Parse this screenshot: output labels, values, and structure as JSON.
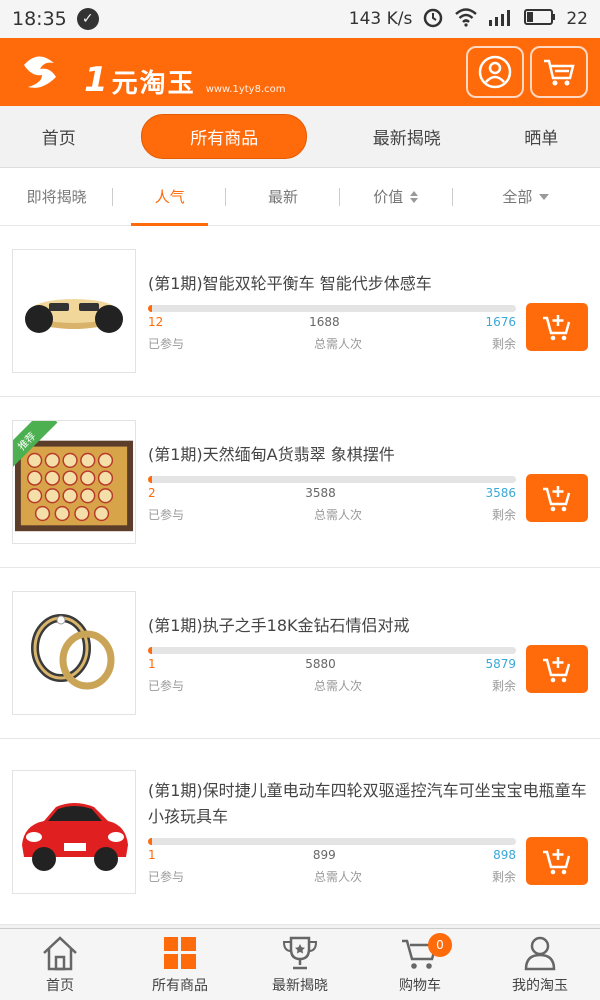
{
  "status_bar": {
    "time": "18:35",
    "speed": "143 K/s",
    "battery": "22"
  },
  "header": {
    "logo_mark": "1",
    "logo_text": "元淘玉",
    "logo_sub": "www.1yty8.com"
  },
  "nav_tabs": [
    {
      "label": "首页"
    },
    {
      "label": "所有商品"
    },
    {
      "label": "最新揭晓"
    },
    {
      "label": "晒单"
    }
  ],
  "filters": [
    {
      "label": "即将揭晓"
    },
    {
      "label": "人气"
    },
    {
      "label": "最新"
    },
    {
      "label": "价值"
    },
    {
      "label": "全部"
    }
  ],
  "products": [
    {
      "title": "(第1期)智能双轮平衡车 智能代步体感车",
      "joined": "12",
      "total": "1688",
      "remaining": "1676",
      "progress": 0.0071,
      "tag": ""
    },
    {
      "title": "(第1期)天然缅甸A货翡翠 象棋摆件",
      "joined": "2",
      "total": "3588",
      "remaining": "3586",
      "progress": 0.0006,
      "tag": "推荐"
    },
    {
      "title": "(第1期)执子之手18K金钻石情侣对戒",
      "joined": "1",
      "total": "5880",
      "remaining": "5879",
      "progress": 0.0002,
      "tag": ""
    },
    {
      "title": "(第1期)保时捷儿童电动车四轮双驱遥控汽车可坐宝宝电瓶童车小孩玩具车",
      "joined": "1",
      "total": "899",
      "remaining": "898",
      "progress": 0.0011,
      "tag": ""
    }
  ],
  "labels": {
    "joined": "已参与",
    "total": "总需人次",
    "remaining": "剩余"
  },
  "bottom_nav": [
    {
      "label": "首页"
    },
    {
      "label": "所有商品"
    },
    {
      "label": "最新揭晓"
    },
    {
      "label": "购物车",
      "badge": "0"
    },
    {
      "label": "我的淘玉"
    }
  ],
  "colors": {
    "accent": "#ff6a0a",
    "remaining": "#3aa8d8"
  }
}
